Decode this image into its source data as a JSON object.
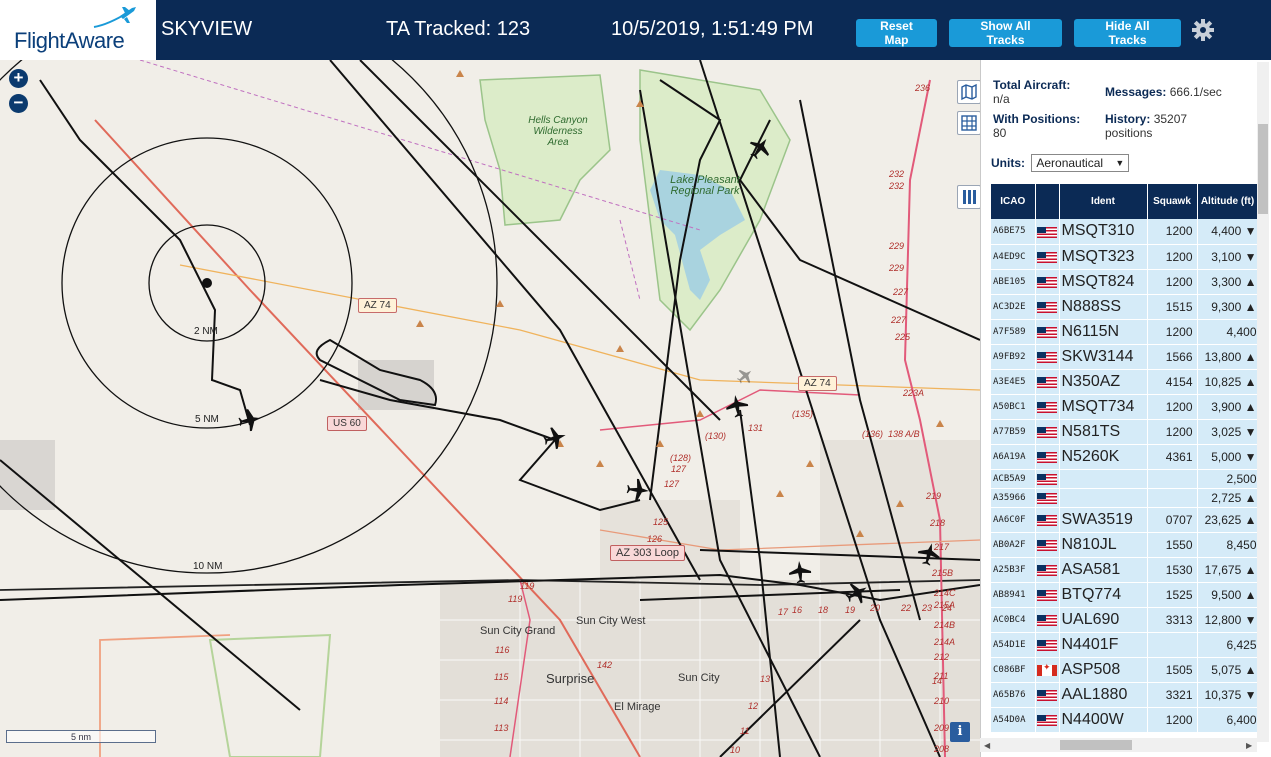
{
  "header": {
    "logo_text": "FlightAware",
    "site_name": "SKYVIEW",
    "ta_tracked": "TA Tracked: 123",
    "clock": "10/5/2019, 1:51:49 PM",
    "reset_map": "Reset Map",
    "show_all_tracks": "Show All Tracks",
    "hide_all_tracks": "Hide All Tracks",
    "settings_icon": "gear-icon"
  },
  "map": {
    "zoom_in": "+",
    "zoom_out": "−",
    "scale_label": "5 nm",
    "info": "i",
    "range_rings": [
      "2 NM",
      "5 NM",
      "10 NM"
    ],
    "shields": [
      "AZ 74",
      "AZ 74",
      "US 60",
      "AZ 303 Loop"
    ],
    "park_labels": [
      "Hells Canyon Wilderness Area",
      "Lake Pleasant Regional Park"
    ],
    "places": [
      "Sun City Grand",
      "Sun City West",
      "Surprise",
      "Sun City",
      "El Mirage"
    ],
    "route_numbers": [
      "236",
      "232",
      "232",
      "229",
      "229",
      "227",
      "227",
      "225",
      "223A",
      "219",
      "(135)",
      "(136)",
      "138 A/B",
      "131",
      "(130)",
      "(128)",
      "127",
      "127",
      "126",
      "125",
      "119",
      "119",
      "116",
      "115",
      "114",
      "113",
      "142",
      "17",
      "16",
      "18",
      "19",
      "20",
      "22",
      "23",
      "24",
      "218",
      "217",
      "215B",
      "215A",
      "214C",
      "214B",
      "214A",
      "212",
      "211",
      "210",
      "209",
      "208",
      "14",
      "13",
      "12",
      "11",
      "10"
    ],
    "icons": [
      "layers-icon",
      "grid-icon",
      "columns-icon",
      "airplane-icon",
      "home-location-icon"
    ]
  },
  "panel": {
    "total_aircraft_label": "Total Aircraft:",
    "total_aircraft_value": "n/a",
    "with_positions_label": "With Positions:",
    "with_positions_value": "80",
    "messages_label": "Messages:",
    "messages_value": "666.1/sec",
    "history_label": "History:",
    "history_value": "35207 positions",
    "units_label": "Units:",
    "units_value": "Aeronautical",
    "columns": [
      "ICAO",
      "",
      "Ident",
      "Squawk",
      "Altitude (ft)"
    ],
    "rows": [
      {
        "icao": "A6BE75",
        "flag": "us",
        "ident": "MSQT310",
        "squawk": "1200",
        "alt": "4,400 ▼"
      },
      {
        "icao": "A4ED9C",
        "flag": "us",
        "ident": "MSQT323",
        "squawk": "1200",
        "alt": "3,100 ▼"
      },
      {
        "icao": "ABE105",
        "flag": "us",
        "ident": "MSQT824",
        "squawk": "1200",
        "alt": "3,300 ▲"
      },
      {
        "icao": "AC3D2E",
        "flag": "us",
        "ident": "N888SS",
        "squawk": "1515",
        "alt": "9,300 ▲"
      },
      {
        "icao": "A7F589",
        "flag": "us",
        "ident": "N6115N",
        "squawk": "1200",
        "alt": "4,400"
      },
      {
        "icao": "A9FB92",
        "flag": "us",
        "ident": "SKW3144",
        "squawk": "1566",
        "alt": "13,800 ▲"
      },
      {
        "icao": "A3E4E5",
        "flag": "us",
        "ident": "N350AZ",
        "squawk": "4154",
        "alt": "10,825 ▲"
      },
      {
        "icao": "A50BC1",
        "flag": "us",
        "ident": "MSQT734",
        "squawk": "1200",
        "alt": "3,900 ▲"
      },
      {
        "icao": "A77B59",
        "flag": "us",
        "ident": "N581TS",
        "squawk": "1200",
        "alt": "3,025 ▼"
      },
      {
        "icao": "A6A19A",
        "flag": "us",
        "ident": "N5260K",
        "squawk": "4361",
        "alt": "5,000 ▼"
      },
      {
        "icao": "ACB5A9",
        "flag": "us",
        "ident": "",
        "squawk": "",
        "alt": "2,500"
      },
      {
        "icao": "A35966",
        "flag": "us",
        "ident": "",
        "squawk": "",
        "alt": "2,725 ▲"
      },
      {
        "icao": "AA6C0F",
        "flag": "us",
        "ident": "SWA3519",
        "squawk": "0707",
        "alt": "23,625 ▲"
      },
      {
        "icao": "AB0A2F",
        "flag": "us",
        "ident": "N810JL",
        "squawk": "1550",
        "alt": "8,450"
      },
      {
        "icao": "A25B3F",
        "flag": "us",
        "ident": "ASA581",
        "squawk": "1530",
        "alt": "17,675 ▲"
      },
      {
        "icao": "AB8941",
        "flag": "us",
        "ident": "BTQ774",
        "squawk": "1525",
        "alt": "9,500 ▲"
      },
      {
        "icao": "AC0BC4",
        "flag": "us",
        "ident": "UAL690",
        "squawk": "3313",
        "alt": "12,800 ▼"
      },
      {
        "icao": "A54D1E",
        "flag": "us",
        "ident": "N4401F",
        "squawk": "",
        "alt": "6,425"
      },
      {
        "icao": "C086BF",
        "flag": "ca",
        "ident": "ASP508",
        "squawk": "1505",
        "alt": "5,075 ▲"
      },
      {
        "icao": "A65B76",
        "flag": "us",
        "ident": "AAL1880",
        "squawk": "3321",
        "alt": "10,375 ▼"
      },
      {
        "icao": "A54D0A",
        "flag": "us",
        "ident": "N4400W",
        "squawk": "1200",
        "alt": "6,400"
      }
    ]
  },
  "colors": {
    "header_bg": "#0b2a55",
    "button_bg": "#1a9ad8",
    "row_bg": "#d5ebf8",
    "map_bg": "#f1eee8",
    "water": "#a9d3df",
    "park": "#d5ecc2"
  }
}
